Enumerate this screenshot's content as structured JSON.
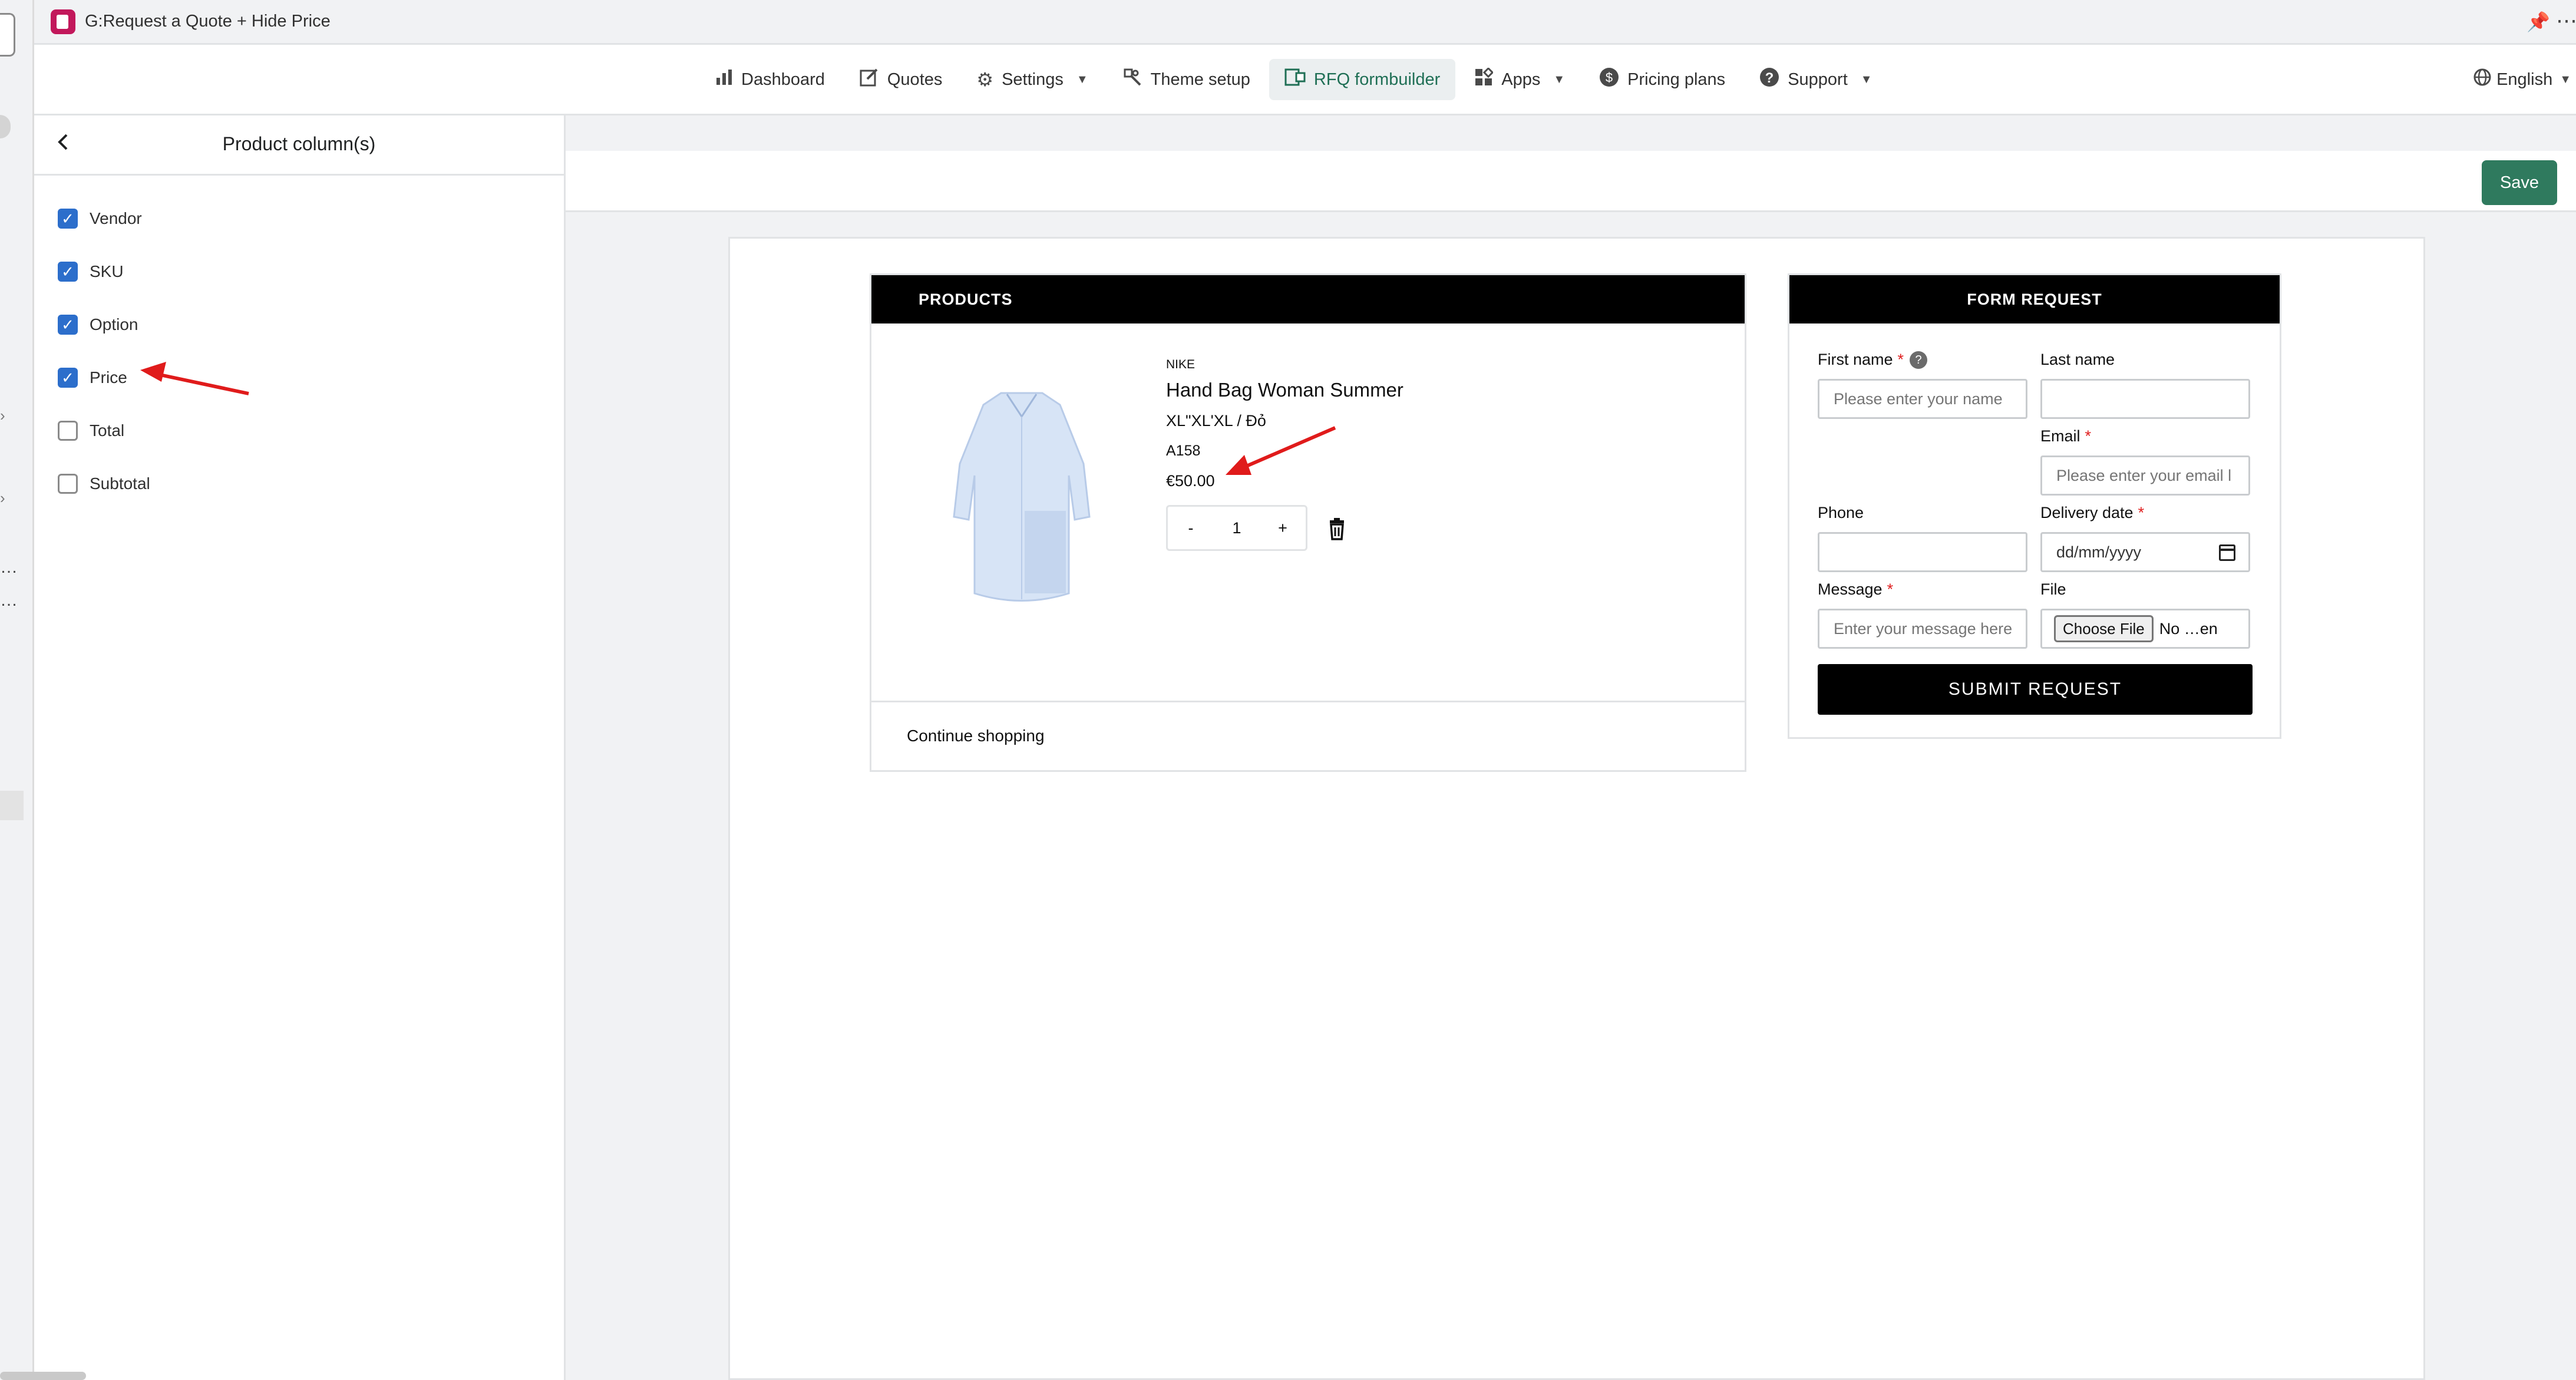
{
  "app": {
    "title": "G:Request a Quote + Hide Price"
  },
  "nav": {
    "items": [
      {
        "label": "Dashboard",
        "icon": "bar-chart-icon"
      },
      {
        "label": "Quotes",
        "icon": "edit-icon"
      },
      {
        "label": "Settings",
        "icon": "gear-icon"
      },
      {
        "label": "Theme setup",
        "icon": "theme-icon"
      },
      {
        "label": "RFQ formbuilder",
        "icon": "formbuilder-icon",
        "active": true
      },
      {
        "label": "Apps",
        "icon": "apps-icon"
      },
      {
        "label": "Pricing plans",
        "icon": "dollar-icon"
      },
      {
        "label": "Support",
        "icon": "help-icon"
      }
    ],
    "language": "English"
  },
  "panel": {
    "title": "Product column(s)",
    "columns": [
      {
        "label": "Vendor",
        "checked": true
      },
      {
        "label": "SKU",
        "checked": true
      },
      {
        "label": "Option",
        "checked": true
      },
      {
        "label": "Price",
        "checked": true
      },
      {
        "label": "Total",
        "checked": false
      },
      {
        "label": "Subtotal",
        "checked": false
      }
    ]
  },
  "toolbar": {
    "save_label": "Save"
  },
  "products": {
    "header": "PRODUCTS",
    "item": {
      "vendor": "NIKE",
      "name": "Hand Bag Woman Summer",
      "option": "XL\"XL'XL / Đỏ",
      "sku": "A158",
      "price": "€50.00",
      "quantity": "1",
      "minus": "-",
      "plus": "+"
    },
    "continue_label": "Continue shopping"
  },
  "form": {
    "header": "FORM REQUEST",
    "first_name": {
      "label": "First name",
      "placeholder": "Please enter your name"
    },
    "last_name": {
      "label": "Last name",
      "placeholder": ""
    },
    "email": {
      "label": "Email",
      "placeholder": "Please enter your email l"
    },
    "phone": {
      "label": "Phone",
      "placeholder": ""
    },
    "delivery_date": {
      "label": "Delivery date",
      "placeholder": "dd/mm/yyyy"
    },
    "message": {
      "label": "Message",
      "placeholder": "Enter your message here"
    },
    "file": {
      "label": "File",
      "button": "Choose File",
      "status": "No …en"
    },
    "required_mark": "*",
    "help_mark": "?",
    "submit_label": "SUBMIT REQUEST"
  },
  "colors": {
    "accent_green": "#2f7a5e",
    "checkbox_blue": "#2c6ecb",
    "annotation_red": "#e01b1b",
    "header_black": "#000000"
  }
}
